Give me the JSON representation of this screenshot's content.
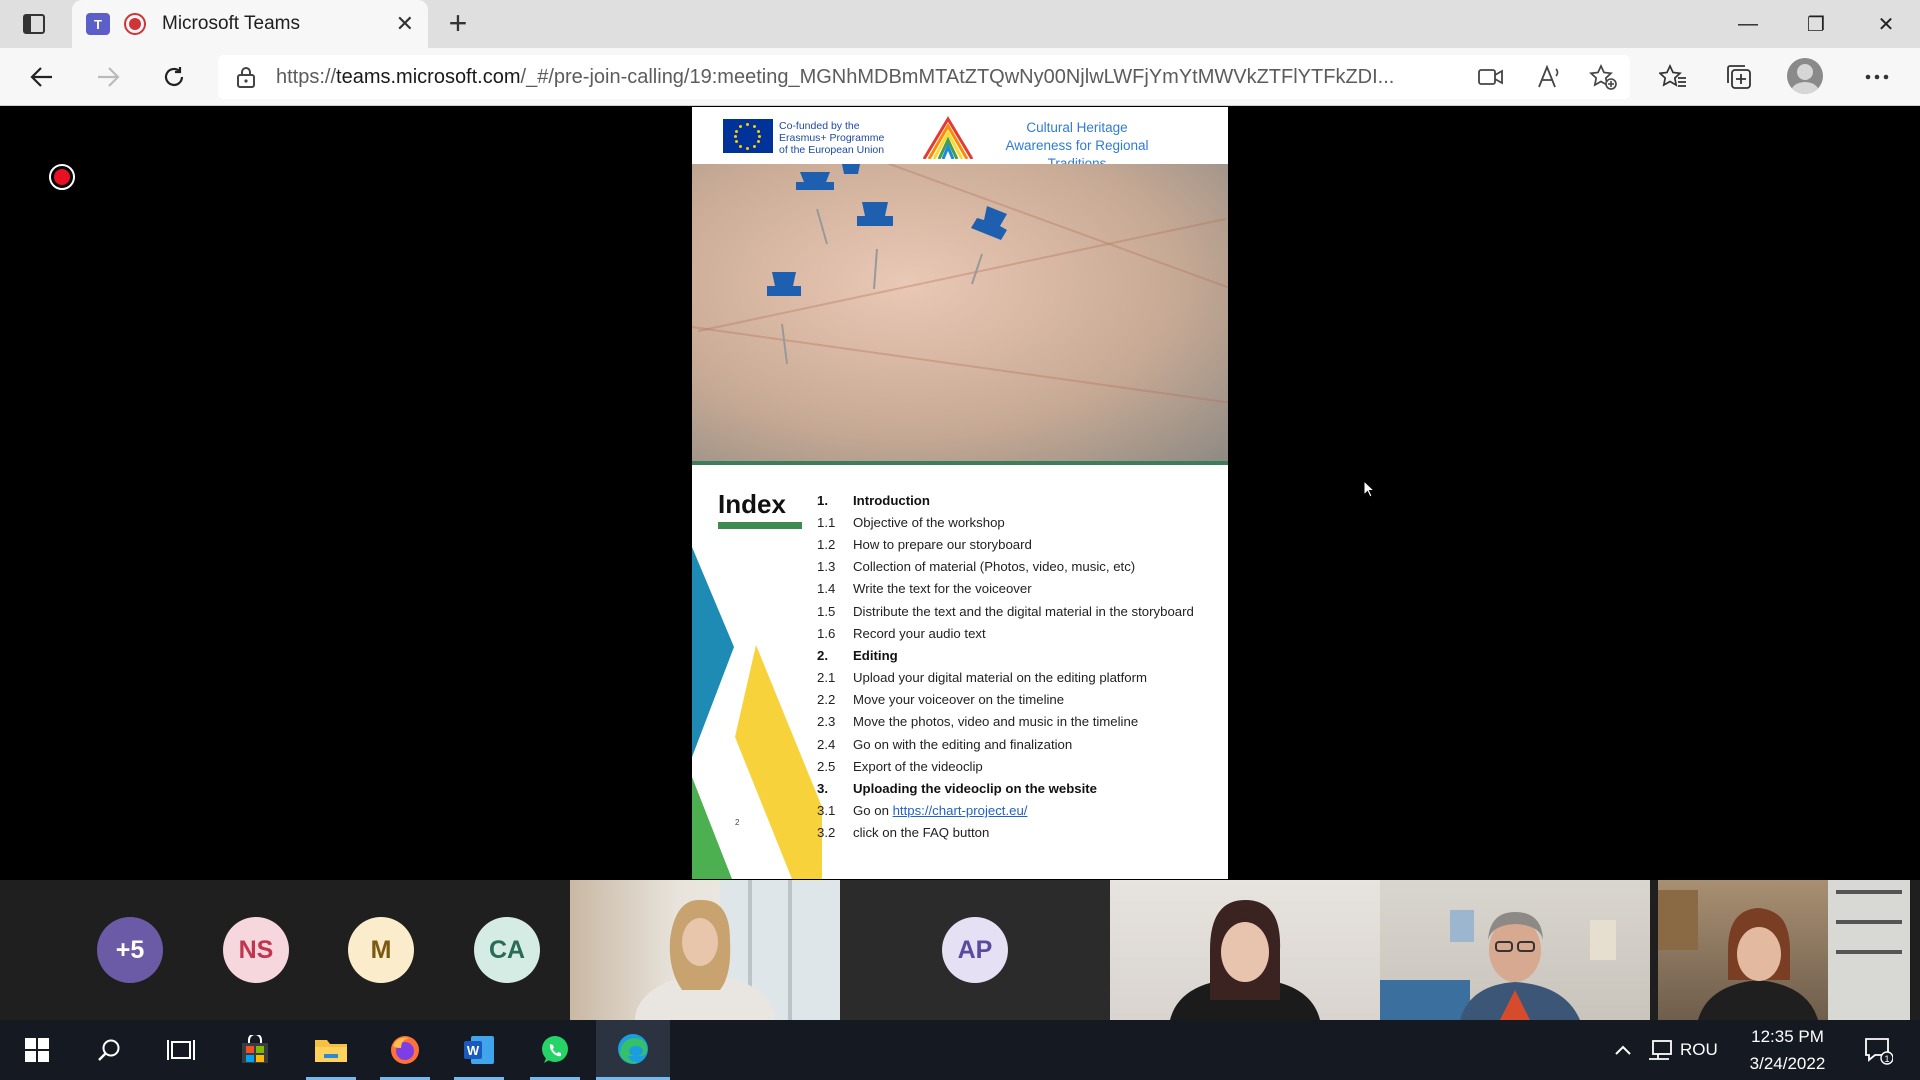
{
  "browser": {
    "tab_title": "Microsoft Teams",
    "tab_close": "✕",
    "new_tab": "+",
    "url_prefix": "https://",
    "url_host": "teams.microsoft.com",
    "url_rest": "/_#/pre-join-calling/19:meeting_MGNhMDBmMTAtZTQwNy00NjlwLWFjYmYtMWVkZTFlYTFkZDI...",
    "window_controls": {
      "minimize": "—",
      "restore": "❐",
      "close": "✕"
    }
  },
  "document": {
    "eu_text": "Co-funded by the Erasmus+ Programme of the European Union",
    "project_title": "Cultural Heritage Awareness for Regional Traditions",
    "index_title": "Index",
    "page_number": "2",
    "items": [
      {
        "num": "1.",
        "text": "Introduction",
        "head": true
      },
      {
        "num": "1.1",
        "text": "Objective of the workshop"
      },
      {
        "num": "1.2",
        "text": "How to prepare our storyboard"
      },
      {
        "num": "1.3",
        "text": "Collection of material (Photos, video, music, etc)"
      },
      {
        "num": "1.4",
        "text": "Write the text for the voiceover"
      },
      {
        "num": "1.5",
        "text": "Distribute the text and the digital material in the storyboard"
      },
      {
        "num": "1.6",
        "text": "Record your audio text"
      },
      {
        "num": "2.",
        "text": "Editing",
        "head": true
      },
      {
        "num": "2.1",
        "text": "Upload your digital material on the editing platform"
      },
      {
        "num": "2.2",
        "text": "Move your voiceover on the timeline"
      },
      {
        "num": "2.3",
        "text": "Move the photos, video and music in the timeline"
      },
      {
        "num": "2.4",
        "text": "Go on with the editing and finalization"
      },
      {
        "num": "2.5",
        "text": "Export of the videoclip"
      },
      {
        "num": "3.",
        "text": "Uploading the videoclip on the website",
        "head": true
      },
      {
        "num": "3.1",
        "text": "Go on ",
        "link": "https://chart-project.eu/"
      },
      {
        "num": "3.2",
        "text": "click on the FAQ button"
      }
    ]
  },
  "participants": {
    "avatars": [
      {
        "label": "+5",
        "bg": "#6b5ba6",
        "fg": "#ffffff"
      },
      {
        "label": "NS",
        "bg": "#f7d7de",
        "fg": "#c2354f"
      },
      {
        "label": "M",
        "bg": "#fbeccb",
        "fg": "#7a5a10"
      },
      {
        "label": "CA",
        "bg": "#d5ece4",
        "fg": "#2a6b57"
      },
      {
        "label": "AP",
        "bg": "#e6e0f4",
        "fg": "#5a4ba0"
      }
    ]
  },
  "taskbar": {
    "language": "ROU",
    "time": "12:35 PM",
    "date": "3/24/2022",
    "notification_count": "1"
  },
  "colors": {
    "teams_purple": "#5b5fc7",
    "record_red": "#e81123",
    "taskbar": "#151a22"
  }
}
